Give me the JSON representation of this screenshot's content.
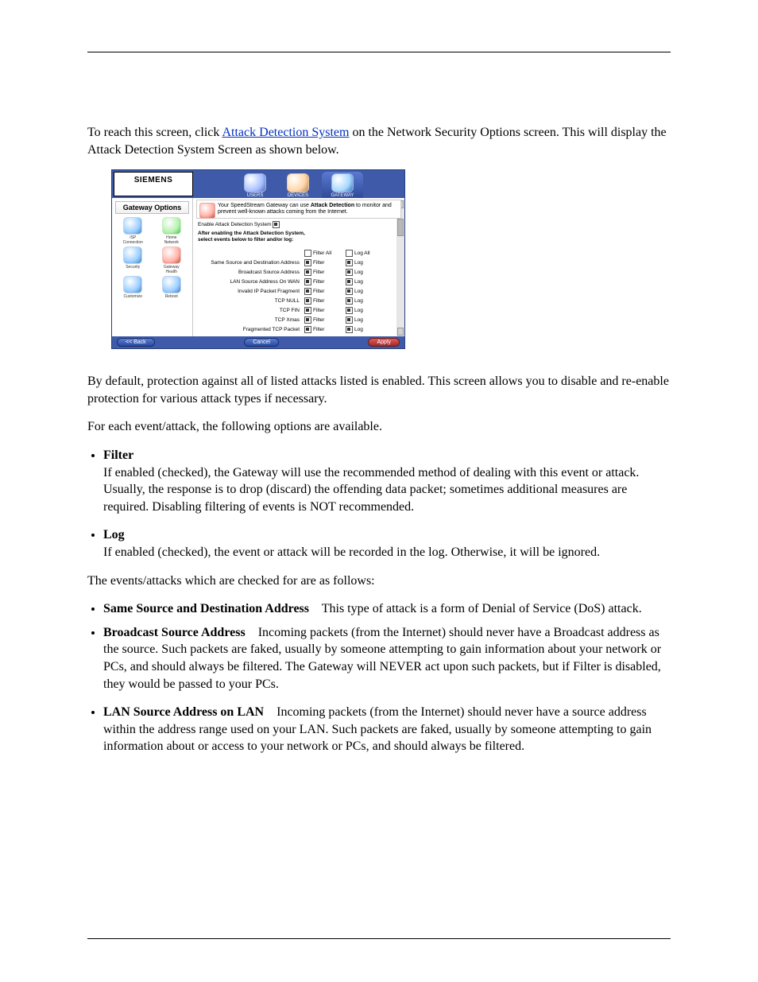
{
  "intro": {
    "p1_pre": "To reach this screen, click ",
    "link": "Attack Detection System",
    "p1_post": " on the Network Security Options screen. This will display the Attack Detection System Screen as shown below."
  },
  "screenshot": {
    "brand": "SIEMENS",
    "side_title": "Gateway Options",
    "tabs": [
      {
        "label": "USERS"
      },
      {
        "label": "DEVICES"
      },
      {
        "label": "GATEWAY"
      }
    ],
    "side_items": [
      {
        "l1": "ISP",
        "l2": "Connection"
      },
      {
        "l1": "Home",
        "l2": "Network"
      },
      {
        "l1": "Security",
        "l2": ""
      },
      {
        "l1": "Gateway",
        "l2": "Health"
      },
      {
        "l1": "Customize",
        "l2": ""
      },
      {
        "l1": "Reboot",
        "l2": ""
      }
    ],
    "banner_a": "Your SpeedStream Gateway can use ",
    "banner_b": "Attack Detection",
    "banner_c": " to monitor and prevent well-known attacks coming from the Internet.",
    "enable_label": "Enable Attack Detection System",
    "after_l1": "After enabling the Attack Detection System,",
    "after_l2": "select events below to filter and/or log:",
    "col_filter_all": "Filter All",
    "col_log_all": "Log All",
    "col_filter": "Filter",
    "col_log": "Log",
    "rows": [
      "Same Source and Destination Address",
      "Broadcast Source Address",
      "LAN Source Address On WAN",
      "Invalid IP Packet Fragment",
      "TCP NULL",
      "TCP FIN",
      "TCP Xmas",
      "Fragmented TCP Packet"
    ],
    "btn_back": "<< Back",
    "btn_cancel": "Cancel",
    "btn_apply": "Apply"
  },
  "after_shot": "By default, protection against all of listed attacks listed is enabled. This screen allows you to disable and re-enable protection for various attack types if necessary.",
  "for_each": "For each event/attack, the following options are available.",
  "bullets": {
    "b1_t": "Filter",
    "b1_d": "If enabled (checked), the Gateway will use the recommended method of dealing with this event or attack. Usually, the response is to drop (discard) the offending data packet; sometimes additional measures are required. Disabling filtering of events is NOT recommended.",
    "b2_t": "Log",
    "b2_d": "If enabled (checked), the event or attack will be recorded in the log. Otherwise, it will be ignored."
  },
  "events_intro": "The events/attacks which are checked for are as follows:",
  "events": {
    "e1_t": "Same Source and Destination Address",
    "e1_d": "This type of attack is a form of Denial of Service (DoS) attack.",
    "e2_t": "Broadcast Source Address",
    "e2_d": "Incoming packets (from the Internet) should never have a Broadcast address as the source. Such packets are faked, usually by someone attempting to gain information about your network or PCs, and should always be filtered. The Gateway will NEVER act upon such packets, but if Filter is disabled, they would be passed to your PCs.",
    "e3_t": "LAN Source Address on LAN",
    "e3_d": "Incoming packets (from the Internet) should never have a source address within the address range used on your LAN. Such packets are faked, usually by someone attempting to gain information about or access to your network or PCs, and should always be filtered."
  }
}
